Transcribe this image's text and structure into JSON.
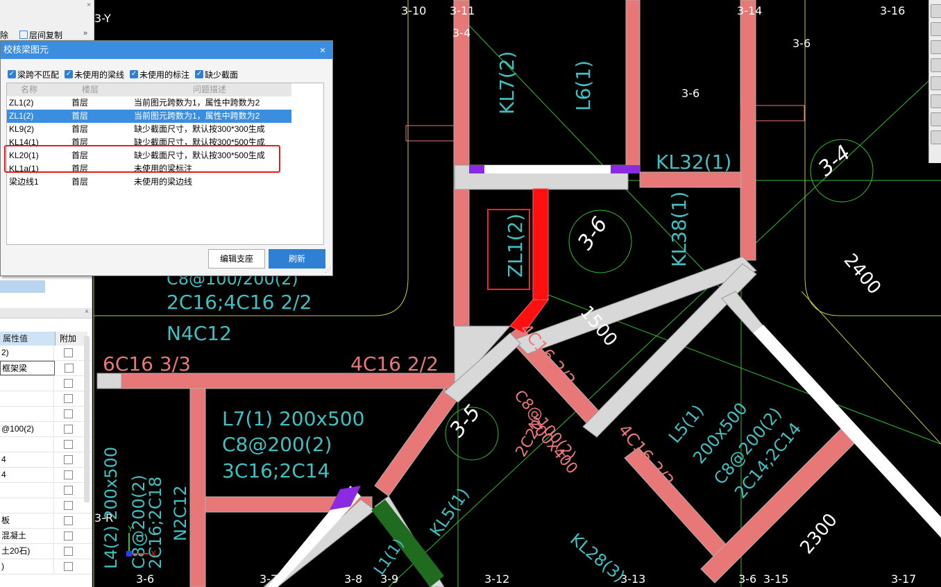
{
  "dialog": {
    "title": "校核梁图元",
    "filters": [
      {
        "label": "梁跨不匹配",
        "checked": true
      },
      {
        "label": "未使用的梁线",
        "checked": true
      },
      {
        "label": "未使用的标注",
        "checked": true
      },
      {
        "label": "缺少截面",
        "checked": true
      }
    ],
    "columns": {
      "name": "名称",
      "floor": "楼层",
      "desc": "问题描述"
    },
    "rows": [
      {
        "name": "ZL1(2)",
        "floor": "首层",
        "desc": "当前图元跨数为1，属性中跨数为2"
      },
      {
        "name": "ZL1(2)",
        "floor": "首层",
        "desc": "当前图元跨数为1，属性中跨数为2"
      },
      {
        "name": "KL9(2)",
        "floor": "首层",
        "desc": "缺少截面尺寸，默认按300*300生成"
      },
      {
        "name": "KL14(1)",
        "floor": "首层",
        "desc": "缺少截面尺寸，默认按300*500生成"
      },
      {
        "name": "KL20(1)",
        "floor": "首层",
        "desc": "缺少截面尺寸，默认按300*500生成"
      },
      {
        "name": "KL1a(1)",
        "floor": "首层",
        "desc": "未使用的梁标注"
      },
      {
        "name": "梁边线1",
        "floor": "首层",
        "desc": "未使用的梁边线"
      }
    ],
    "selected_row": 1,
    "edit_button": "编辑支座",
    "refresh_button": "刷新",
    "close_glyph": "×"
  },
  "ribbon": {
    "delete_label": "除",
    "copy_floor_label": "层间复制",
    "more_glyph": "»",
    "close_glyph": "×"
  },
  "props": {
    "header_value": "属性值",
    "header_extra": "附加",
    "values": [
      "2)",
      "框架梁",
      "",
      "",
      "",
      "@100(2)",
      "",
      "4",
      "4",
      "",
      "",
      "板",
      "混凝土",
      "土20石)",
      ")"
    ]
  },
  "cad": {
    "axis_labels": [
      "3-Y",
      "3-10",
      "3-11",
      "3-14",
      "3-16",
      "3-4",
      "3-6",
      "3-6",
      "3-R",
      "3-6",
      "3-7",
      "3-8",
      "3-9",
      "3-12",
      "3-13",
      "3-6",
      "3-15",
      "3-17"
    ],
    "circles": [
      "3-4",
      "3-6",
      "3-5"
    ],
    "beam_labels": [
      "KL7(2)",
      "L6(1)",
      "KL32(1)",
      "KL38(1)",
      "ZL1(2)",
      "L7(1) 200x500",
      "C8@200(2)",
      "3C16;2C14",
      "L5(1)",
      "200x500",
      "C8@200(2)",
      "2C14;2C14",
      "KL5(1)",
      "KL28(3)",
      "C8@100(2)",
      "200x400",
      "2C20",
      "4C16 2/2",
      "4C16 2/2",
      "6C16 3/3",
      "4C16 2/2",
      "N4C12",
      "2C16;4C16 2/2",
      "C8@100/200(2)",
      "L4(2) 200x500",
      "C8@200(2)",
      "2C16;2C18",
      "N2C12",
      "L1(1)"
    ],
    "dims": [
      "2400",
      "1500",
      "2300"
    ],
    "axis_x": "X",
    "axis_y": "Y"
  }
}
